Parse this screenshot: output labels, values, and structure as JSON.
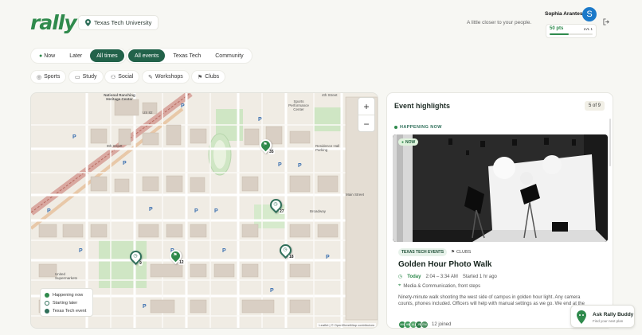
{
  "app": {
    "logo": "rally",
    "tagline": "A little closer to your people."
  },
  "location": {
    "label": "Texas Tech  University"
  },
  "user": {
    "name": "Sophia Arantes",
    "initial": "S",
    "points": "50 pts",
    "level": "LVL 1",
    "progress": 0.45
  },
  "time_filters": [
    {
      "label": "Now",
      "active": false
    },
    {
      "label": "Later",
      "active": false
    },
    {
      "label": "All times",
      "active": true
    }
  ],
  "scope_filters": [
    {
      "label": "All events",
      "active": true
    },
    {
      "label": "Texas Tech",
      "active": false
    },
    {
      "label": "Community",
      "active": false
    }
  ],
  "categories": [
    {
      "label": "Sports",
      "icon": "sports-icon"
    },
    {
      "label": "Study",
      "icon": "book-icon"
    },
    {
      "label": "Social",
      "icon": "people-icon"
    },
    {
      "label": "Workshops",
      "icon": "wrench-icon"
    },
    {
      "label": "Clubs",
      "icon": "flag-icon"
    }
  ],
  "map": {
    "zoom_in": "+",
    "zoom_out": "−",
    "labels": {
      "heritage": "National Ranching Heritage Center",
      "sports": "Sports Performance Center",
      "rec": "Recreation",
      "parking": "Residence Hall Parking",
      "supermarkets": "United Supermarkets",
      "garden": "Student Recreation Garden",
      "us82": "US 82",
      "fourth": "4th Street",
      "eighth": "8th Street",
      "ninth": "9th Street",
      "main": "Main Street",
      "broadway": "Broadway",
      "univ": "University Avenue",
      "ave_x": "Avenue X",
      "ave_w": "Avenue W"
    },
    "markers": [
      {
        "count": "35",
        "type": "now",
        "glyph": "flag-icon"
      },
      {
        "count": "27",
        "type": "later",
        "glyph": "clock-icon"
      },
      {
        "count": "12",
        "type": "now",
        "glyph": "flag-icon"
      },
      {
        "count": "9",
        "type": "later",
        "glyph": "clock-icon"
      },
      {
        "count": "18",
        "type": "later",
        "glyph": "clock-icon"
      }
    ],
    "legend": [
      {
        "label": "Happening now",
        "color": "#2f8a4c"
      },
      {
        "label": "Starting later",
        "color": "#ffffff"
      },
      {
        "label": "Texas Tech event",
        "color": "#2f6f5a"
      }
    ],
    "attribution": "Leaflet | © OpenStreetMap contributors"
  },
  "highlights": {
    "title": "Event highlights",
    "counter": "5 of 9",
    "section": "HAPPENING NOW",
    "badge": "NOW",
    "tag_primary": "TEXAS TECH EVENTS",
    "tag_secondary": "CLUBS",
    "event_title": "Golden Hour Photo Walk",
    "day": "Today",
    "time": "2:04 – 3:34 AM",
    "started": "Started 1 hr ago",
    "organizer": "Media & Communication, front steps",
    "description": "Ninety-minute walk shooting the west side of campus in golden hour light. Any camera counts, phones included. Officers will help with manual settings as we go. We end at the",
    "joined": "12 joined",
    "avatars": [
      "MK",
      "HB",
      "AL",
      "JR",
      "EM"
    ]
  },
  "buddy": {
    "title": "Ask Rally Buddy",
    "subtitle": "Find your next plan"
  },
  "colors": {
    "accent": "#2f8a4c",
    "dark_accent": "#22624a",
    "avatar": "#1b79c9"
  }
}
